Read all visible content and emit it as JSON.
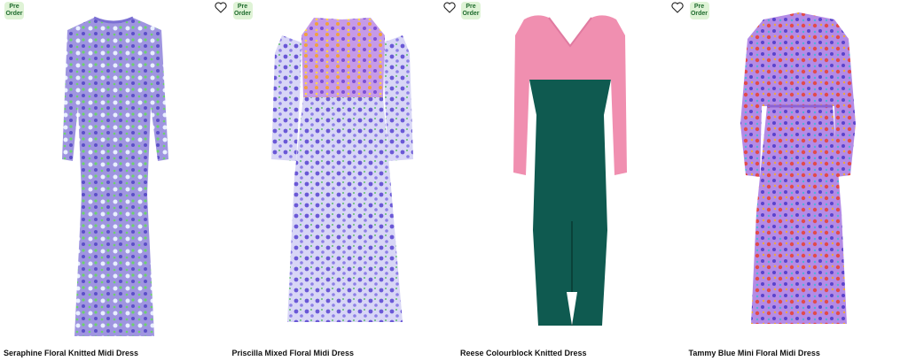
{
  "products": [
    {
      "badge": "Pre Order",
      "name": "Seraphine Floral Knitted Midi Dress"
    },
    {
      "badge": "Pre Order",
      "name": "Priscilla Mixed Floral Midi Dress"
    },
    {
      "badge": "Pre Order",
      "name": "Reese Colourblock Knitted Dress"
    },
    {
      "badge": "Pre Order",
      "name": "Tammy Blue Mini Floral Midi Dress"
    }
  ],
  "icons": {
    "wishlist": "heart-outline-icon"
  },
  "colors": {
    "badge_bg": "#dff3d6",
    "badge_text": "#1f6b2e",
    "dress1": "#9f95e0",
    "dress2": "#b7a4ee",
    "dress3_top": "#f08fb0",
    "dress3_bottom": "#0f5a50",
    "dress4": "#b48be6"
  }
}
